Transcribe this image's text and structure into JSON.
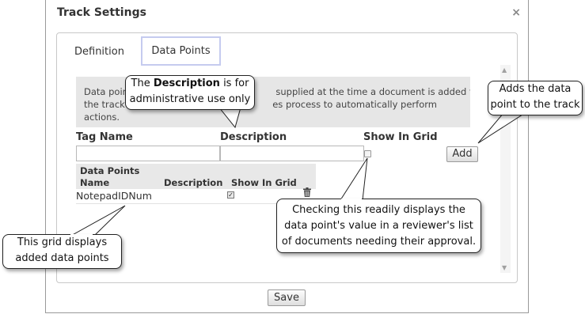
{
  "dialog": {
    "title": "Track Settings",
    "close_glyph": "×"
  },
  "tabs": {
    "definition": "Definition",
    "data_points": "Data Points"
  },
  "info_text": "Data poin                                                   supplied at the time a document is added to\nthe track                                                   es process to automatically perform\nactions.",
  "form": {
    "tag_name_label": "Tag Name",
    "description_label": "Description",
    "show_in_grid_label": "Show In Grid",
    "tag_name_value": "",
    "description_value": "",
    "add_button": "Add"
  },
  "grid": {
    "title": "Data Points",
    "columns": {
      "name": "Name",
      "description": "Description",
      "show_in_grid": "Show In Grid"
    },
    "rows": [
      {
        "name": "NotepadIDNum",
        "description": "",
        "show_in_grid": true
      }
    ]
  },
  "save_button": "Save",
  "callouts": {
    "description_pre": "The ",
    "description_bold": "Description",
    "description_post": " is for",
    "description_line2": "administrative use only",
    "add_line1": "Adds the data",
    "add_line2": "point to the track",
    "checkbox_line1": "Checking this readily displays the",
    "checkbox_line2": "data point's value in a reviewer's list",
    "checkbox_line3": "of documents needing their approval.",
    "grid_line1": "This grid displays",
    "grid_line2": "added data points"
  }
}
